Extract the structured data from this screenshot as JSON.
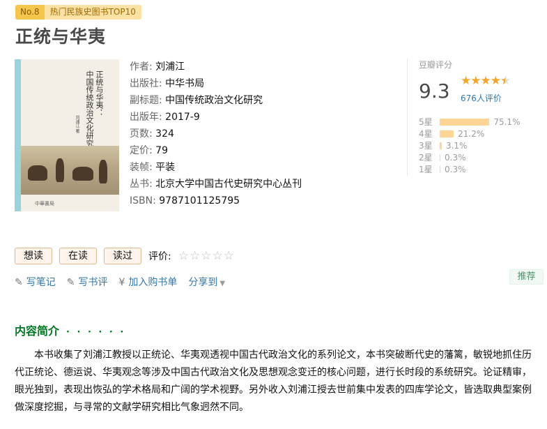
{
  "badge": {
    "rank": "No.8",
    "list": "热门民族史图书TOP10"
  },
  "book": {
    "title": "正统与华夷",
    "cover_title_lines": [
      "正统与华夷：",
      "中国传统政治文化研究"
    ],
    "cover_author": "刘浦江 著",
    "cover_publisher": "中華書局"
  },
  "info": [
    {
      "label": "作者:",
      "value": "刘浦江",
      "link": true
    },
    {
      "label": "出版社:",
      "value": "中华书局",
      "link": true
    },
    {
      "label": "副标题:",
      "value": "中国传统政治文化研究",
      "link": false
    },
    {
      "label": "出版年:",
      "value": "2017-9",
      "link": false
    },
    {
      "label": "页数:",
      "value": "324",
      "link": false
    },
    {
      "label": "定价:",
      "value": "79",
      "link": false
    },
    {
      "label": "装帧:",
      "value": "平装",
      "link": false
    },
    {
      "label": "丛书:",
      "value": "北京大学中国古代史研究中心丛刊",
      "link": true
    },
    {
      "label": "ISBN:",
      "value": "9787101125795",
      "link": false
    }
  ],
  "rating": {
    "label": "豆瓣评分",
    "score": "9.3",
    "stars_filled": 4.5,
    "count": "676人评价",
    "distribution": [
      {
        "star": "5星",
        "percent": 75.1,
        "text": "75.1%"
      },
      {
        "star": "4星",
        "percent": 21.2,
        "text": "21.2%"
      },
      {
        "star": "3星",
        "percent": 3.1,
        "text": "3.1%"
      },
      {
        "star": "2星",
        "percent": 0.3,
        "text": "0.3%"
      },
      {
        "star": "1星",
        "percent": 0.3,
        "text": "0.3%"
      }
    ]
  },
  "actions": {
    "want": "想读",
    "reading": "在读",
    "read": "读过",
    "rate_label": "评价:",
    "rate_stars": "☆☆☆☆☆"
  },
  "links": {
    "note": "写笔记",
    "review": "写书评",
    "cart": "加入购书单",
    "share": "分享到"
  },
  "recommend": "推荐",
  "intro": {
    "title": "内容简介",
    "dots": "· · · · · ·",
    "text": "本书收集了刘浦江教授以正统论、华夷观透视中国古代政治文化的系列论文，本书突破断代史的藩篱，敏锐地抓住历代正统论、德运说、华夷观念等涉及中国古代政治文化及思想观念变迁的核心问题，进行长时段的系统研究。论证精审，眼光独到，表现出恢弘的学术格局和广阔的学术视野。另外收入刘浦江授去世前集中发表的四库学论文，皆选取典型案例做深度挖掘，与寻常的文献学研究相比气象迥然不同。"
  },
  "colors": {
    "link": "#3377aa",
    "green": "#007722",
    "star": "#f1a72b",
    "bar": "#ffd596"
  }
}
